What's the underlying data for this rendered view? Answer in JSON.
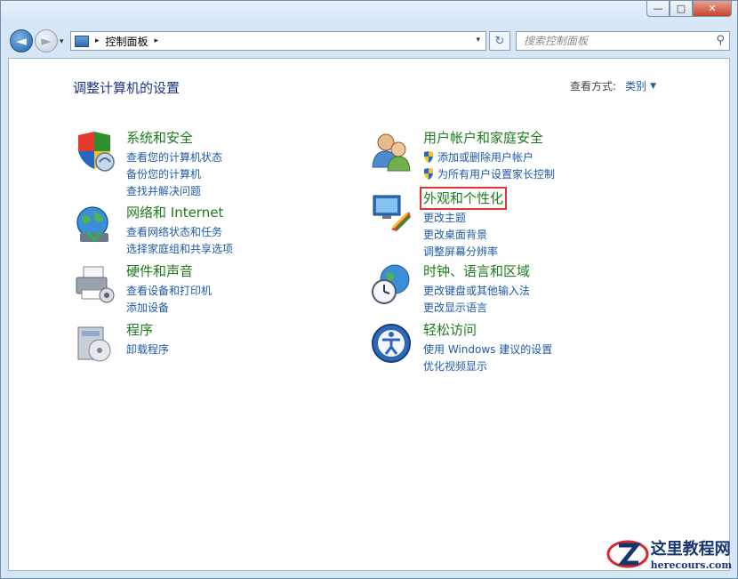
{
  "window": {
    "minimize_glyph": "—",
    "maximize_glyph": "□",
    "close_glyph": "✕"
  },
  "nav": {
    "back_glyph": "◄",
    "forward_glyph": "►",
    "history_glyph": "▾"
  },
  "address": {
    "separator": "▸",
    "crumb": "控制面板",
    "separator2": "▸",
    "dropdown": "▾",
    "refresh_glyph": "↻"
  },
  "search": {
    "placeholder": "搜索控制面板"
  },
  "page": {
    "heading": "调整计算机的设置",
    "view_by_label": "查看方式:",
    "view_by_value": "类别",
    "view_by_caret": "▼"
  },
  "categories": [
    {
      "title": "系统和安全",
      "links": [
        "查看您的计算机状态",
        "备份您的计算机",
        "查找并解决问题"
      ]
    },
    {
      "title": "网络和 Internet",
      "links": [
        "查看网络状态和任务",
        "选择家庭组和共享选项"
      ]
    },
    {
      "title": "硬件和声音",
      "links": [
        "查看设备和打印机",
        "添加设备"
      ]
    },
    {
      "title": "程序",
      "links": [
        "卸载程序"
      ]
    },
    {
      "title": "用户帐户和家庭安全",
      "links": [
        "添加或删除用户帐户",
        "为所有用户设置家长控制"
      ]
    },
    {
      "title": "外观和个性化",
      "links": [
        "更改主题",
        "更改桌面背景",
        "调整屏幕分辨率"
      ]
    },
    {
      "title": "时钟、语言和区域",
      "links": [
        "更改键盘或其他输入法",
        "更改显示语言"
      ]
    },
    {
      "title": "轻松访问",
      "links": [
        "使用 Windows 建议的设置",
        "优化视频显示"
      ]
    }
  ],
  "watermark": {
    "name": "这里教程网",
    "url": "herecours.com"
  },
  "colors": {
    "title_green": "#1c7c1c",
    "link_blue": "#1e5aa8",
    "heading_blue": "#1e3287",
    "highlight_red": "#e3342f"
  }
}
